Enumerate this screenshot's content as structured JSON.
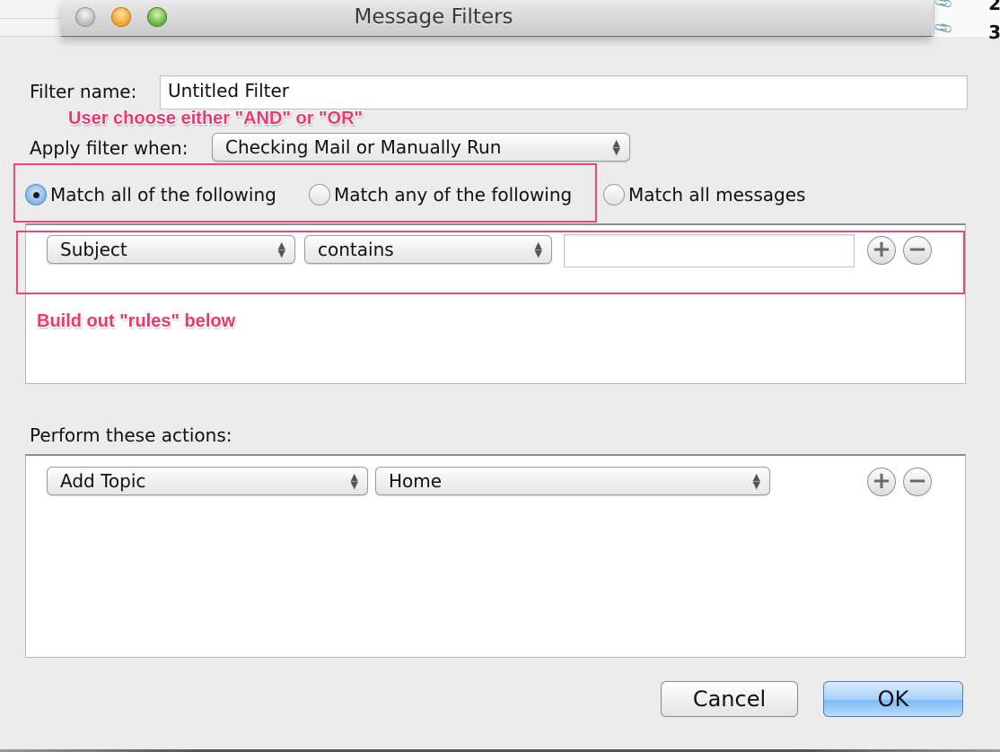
{
  "window": {
    "title": "Message Filters",
    "background_rows": [
      "2",
      "3"
    ]
  },
  "form": {
    "filter_name_label": "Filter name:",
    "filter_name_value": "Untitled Filter",
    "apply_when_label": "Apply filter when:",
    "apply_when_value": "Checking Mail or Manually Run",
    "match_options": [
      {
        "label": "Match all of the following",
        "checked": true
      },
      {
        "label": "Match any of the following",
        "checked": false
      },
      {
        "label": "Match all messages",
        "checked": false
      }
    ]
  },
  "criteria": {
    "rows": [
      {
        "field": "Subject",
        "operator": "contains",
        "value": ""
      }
    ]
  },
  "actions": {
    "label": "Perform these actions:",
    "rows": [
      {
        "action": "Add Topic",
        "target": "Home"
      }
    ]
  },
  "buttons": {
    "cancel": "Cancel",
    "ok": "OK",
    "add": "+",
    "remove": "−"
  },
  "annotations": {
    "and_or_note": "User choose either \"AND\" or \"OR\"",
    "rules_note": "Build out \"rules\" below",
    "color": "#f0356f"
  }
}
